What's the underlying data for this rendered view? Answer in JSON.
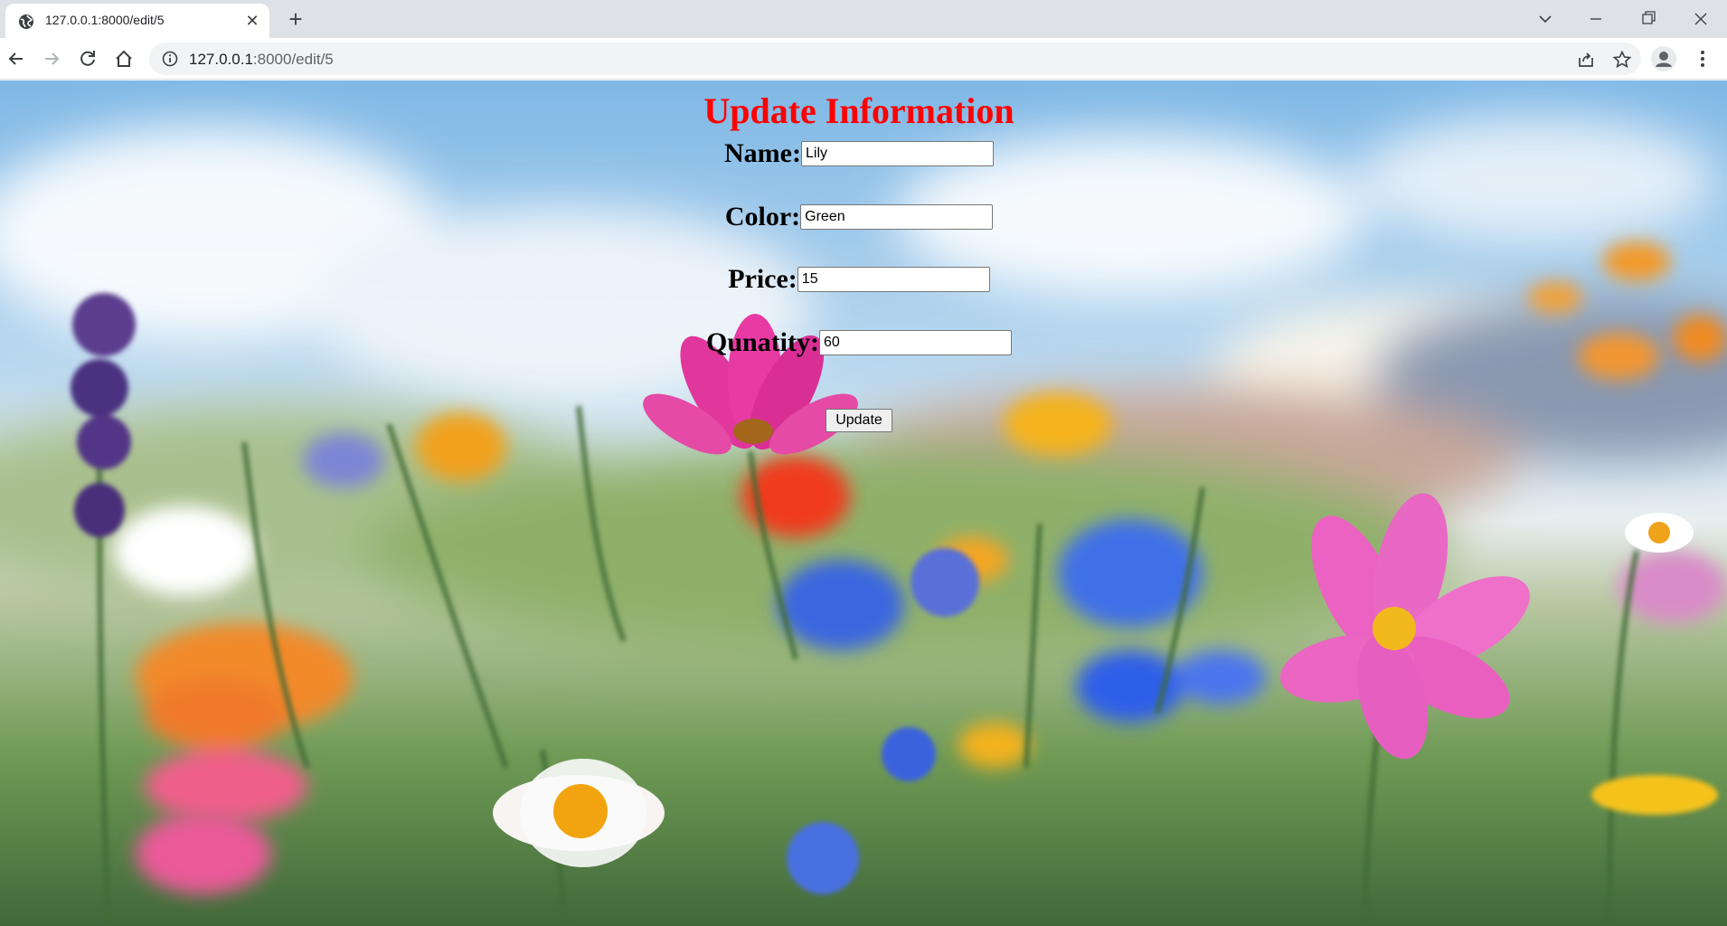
{
  "browser": {
    "tab_title": "127.0.0.1:8000/edit/5",
    "url_host": "127.0.0.1",
    "url_path": ":8000/edit/5"
  },
  "page": {
    "title": "Update Information",
    "title_color": "#ff0000",
    "fields": [
      {
        "label": "Name:",
        "value": "Lily"
      },
      {
        "label": "Color:",
        "value": "Green"
      },
      {
        "label": "Price:",
        "value": "15"
      },
      {
        "label": "Qunatity:",
        "value": "60"
      }
    ],
    "submit_label": "Update"
  }
}
